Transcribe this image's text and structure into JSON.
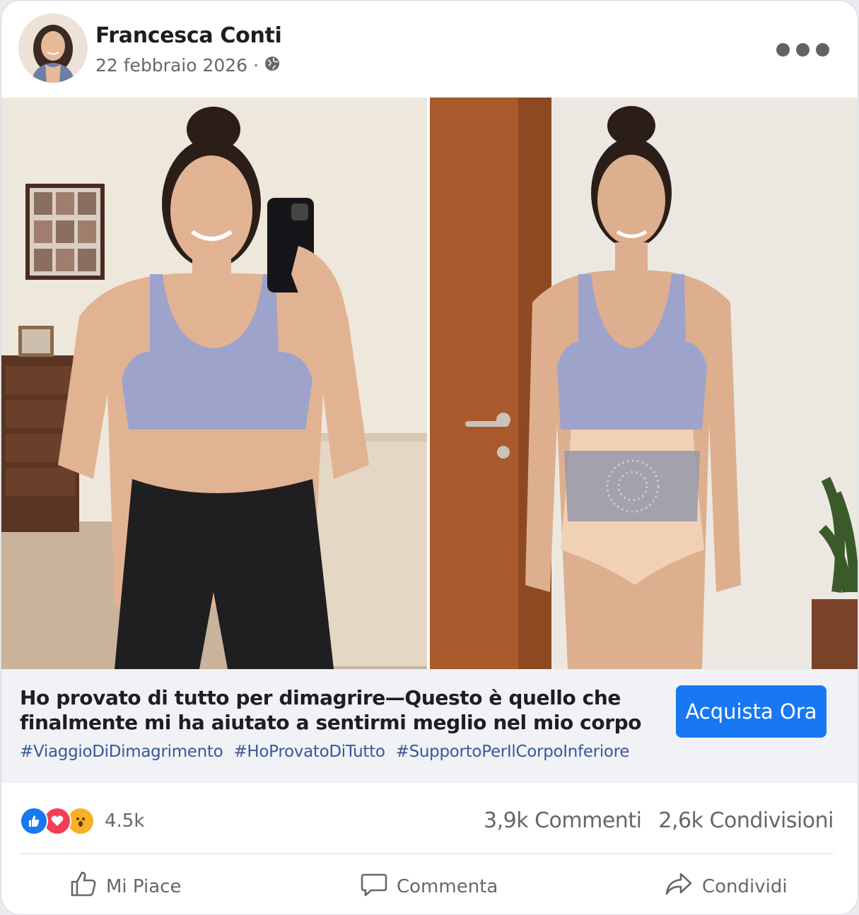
{
  "post": {
    "author": "Francesca Conti",
    "date": "22 febbraio 2026",
    "separator": "·",
    "audience_icon": "globe-icon",
    "more_icon": "more-options-icon"
  },
  "cta": {
    "headline": "Ho provato di tutto per dimagrire—Questo è quello che finalmente mi ha aiutato a sentirmi meglio nel mio corpo",
    "hashtags": [
      "#ViaggioDiDimagrimento",
      "#HoProvatoDiTutto",
      "#SupportoPerIlCorpoInferiore"
    ],
    "button_label": "Acquista Ora"
  },
  "stats": {
    "reactions_count": "4.5k",
    "comments": "3,9k Commenti",
    "shares": "2,6k Condivisioni",
    "reaction_icons": [
      "like-reaction-icon",
      "love-reaction-icon",
      "wow-reaction-icon"
    ]
  },
  "actions": {
    "like": "Mi Piace",
    "comment": "Commenta",
    "share": "Condividi"
  },
  "colors": {
    "accent": "#1877f2",
    "hashtag": "#385898",
    "muted_text": "#65676b"
  }
}
